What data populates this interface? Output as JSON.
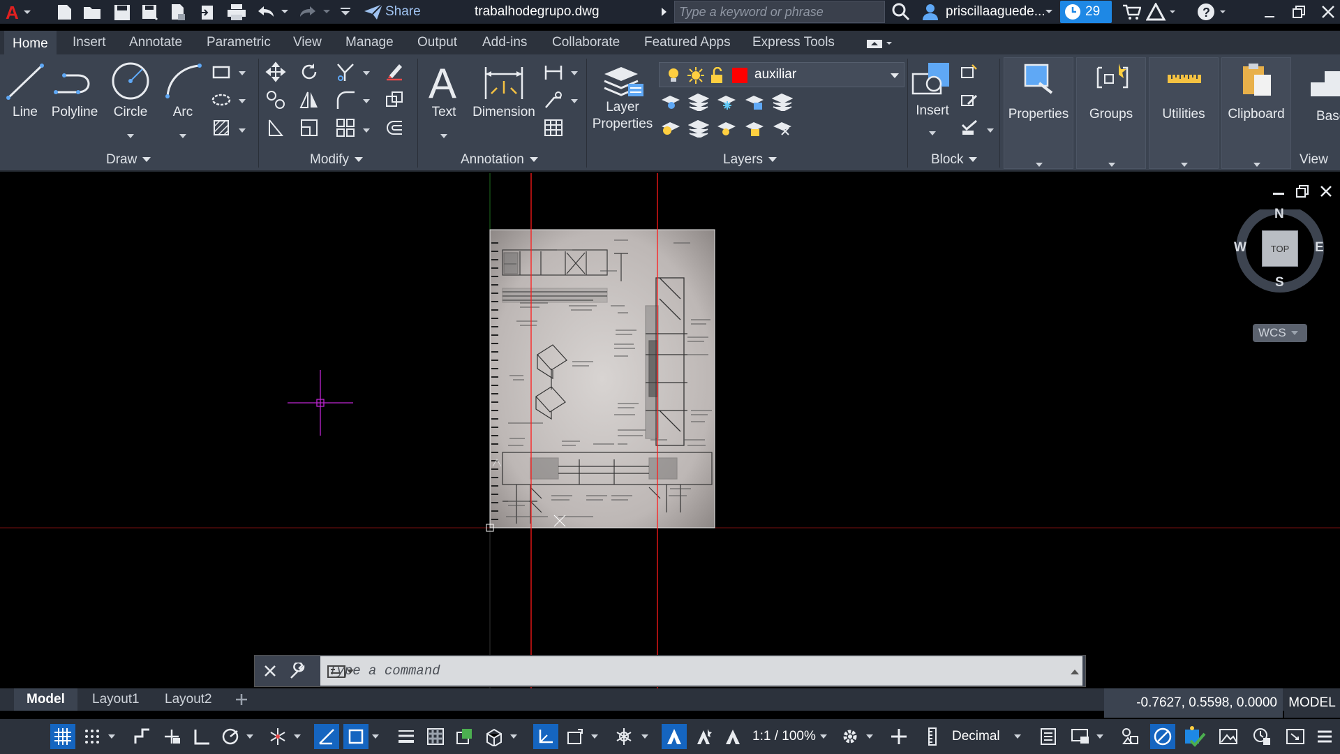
{
  "titlebar": {
    "share_label": "Share",
    "document_title": "trabalhodegrupo.dwg",
    "search_placeholder": "Type a keyword or phrase",
    "user_name": "priscillaaguede...",
    "notification_count": "29",
    "icons": [
      "autocad-logo-icon",
      "new-file-icon",
      "open-file-icon",
      "save-icon",
      "save-as-icon",
      "publish-icon",
      "export-icon",
      "plot-icon",
      "undo-icon",
      "redo-icon",
      "customize-icon",
      "share-icon",
      "search-icon",
      "user-icon",
      "clock-icon",
      "cart-icon",
      "help-icon",
      "minimize-icon",
      "restore-icon",
      "close-icon"
    ]
  },
  "ribbon_tabs": [
    "Home",
    "Insert",
    "Annotate",
    "Parametric",
    "View",
    "Manage",
    "Output",
    "Add-ins",
    "Collaborate",
    "Featured Apps",
    "Express Tools"
  ],
  "ribbon": {
    "draw": {
      "title": "Draw",
      "tools": [
        "Line",
        "Polyline",
        "Circle",
        "Arc"
      ]
    },
    "modify": {
      "title": "Modify"
    },
    "annotation": {
      "title": "Annotation",
      "tools": [
        "Text",
        "Dimension"
      ]
    },
    "layers": {
      "title": "Layers",
      "tool_line1": "Layer",
      "tool_line2": "Properties",
      "current_layer": "auxiliar",
      "current_layer_color": "#ff0000"
    },
    "block": {
      "title": "Block",
      "tool": "Insert"
    },
    "panels": [
      "Properties",
      "Groups",
      "Utilities",
      "Clipboard"
    ],
    "view": {
      "title": "View",
      "partial_label": "Base"
    }
  },
  "viewcube": {
    "north": "N",
    "south": "S",
    "east": "E",
    "west": "W",
    "face": "TOP",
    "ucs": "WCS"
  },
  "command_line": {
    "placeholder": "Type a command"
  },
  "layout_tabs": [
    "Model",
    "Layout1",
    "Layout2"
  ],
  "status": {
    "coordinates": "-0.7627, 0.5598, 0.0000",
    "space": "MODEL",
    "scale": "1:1 / 100%",
    "units": "Decimal"
  },
  "colors": {
    "accent_blue": "#1e88e5",
    "ribbon_bg": "#3b4350",
    "crosshair": "#c026d3",
    "construction_line": "#ff0000"
  }
}
